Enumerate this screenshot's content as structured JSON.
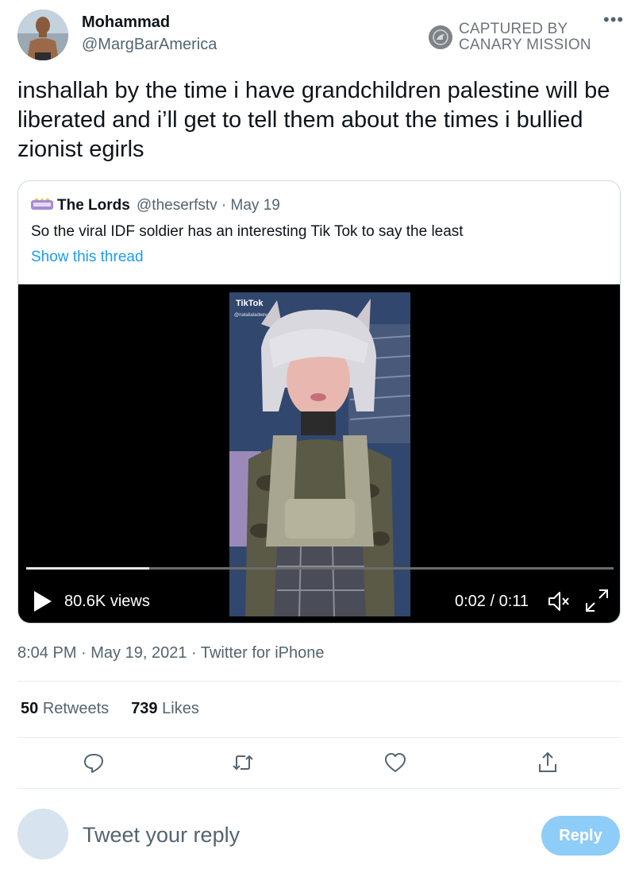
{
  "author": {
    "display_name": "Mohammad",
    "handle": "@MargBarAmerica",
    "avatar_icon": "profile-photo"
  },
  "watermark": {
    "line1": "CAPTURED BY",
    "line2": "CANARY MISSION",
    "icon": "canary-mission-logo"
  },
  "more_icon": "ellipsis-icon",
  "tweet": {
    "text": "inshallah by the time i have grandchildren palestine will be liberated and i’ll get to tell them about the times i bullied zionist egirls",
    "timestamp": "8:04 PM · May 19, 2021 · Twitter for iPhone"
  },
  "quoted_tweet": {
    "display_name": "The Lords",
    "meta": "@theserfstv · May 19",
    "text": "So the viral IDF soldier has an interesting Tik Tok to say the least",
    "show_thread": "Show this thread",
    "video": {
      "watermark_brand": "TikTok",
      "watermark_user": "@natalialadeev",
      "views": "80.6K views",
      "time": "0:02 / 0:11",
      "progress_fraction": 0.21
    }
  },
  "stats": {
    "retweets_count": "50",
    "retweets_label": "Retweets",
    "likes_count": "739",
    "likes_label": "Likes"
  },
  "actions": [
    "reply-icon",
    "retweet-icon",
    "like-icon",
    "share-icon"
  ],
  "reply_box": {
    "placeholder": "Tweet your reply",
    "button_label": "Reply"
  },
  "colors": {
    "link": "#1d9bf0",
    "reply_button": "#8ecdf7",
    "secondary_text": "#536471"
  }
}
